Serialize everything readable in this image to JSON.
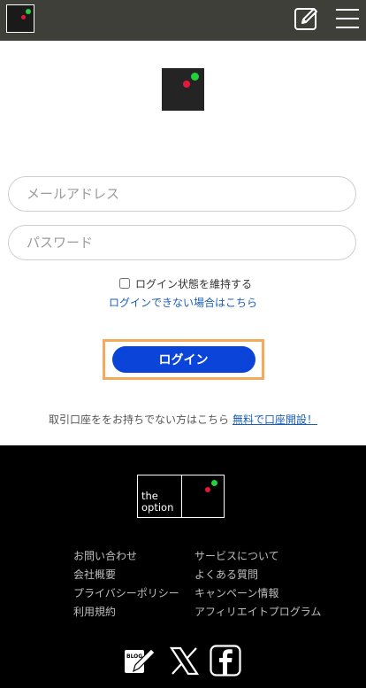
{
  "header": {
    "logo_label": "the option",
    "edit_icon": "edit-icon",
    "menu_icon": "hamburger-menu-icon"
  },
  "form": {
    "email_placeholder": "メールアドレス",
    "password_placeholder": "パスワード",
    "remember_label": "ログイン状態を維持する",
    "forgot_link": "ログインできない場合はこちら",
    "login_button": "ログイン"
  },
  "signup": {
    "text": "取引口座ををお持ちでない方はこちら",
    "link": "無料で口座開設！"
  },
  "footer": {
    "brand_line1": "the",
    "brand_line2": "option",
    "links_col1": [
      "お問い合わせ",
      "会社概要",
      "プライバシーポリシー",
      "利用規約"
    ],
    "links_col2": [
      "サービスについて",
      "よくある質問",
      "キャンペーン情報",
      "アフィリエイトプログラム"
    ],
    "social": {
      "blog_text": "BLOG",
      "icons": [
        "blog-icon",
        "x-icon",
        "facebook-icon"
      ]
    }
  },
  "colors": {
    "header_bg": "#3f3f3a",
    "accent_blue": "#0a44d9",
    "link_blue": "#1a5db8",
    "highlight_orange": "#f5a95a",
    "logo_green": "#22d13a",
    "logo_red": "#e8173a"
  }
}
